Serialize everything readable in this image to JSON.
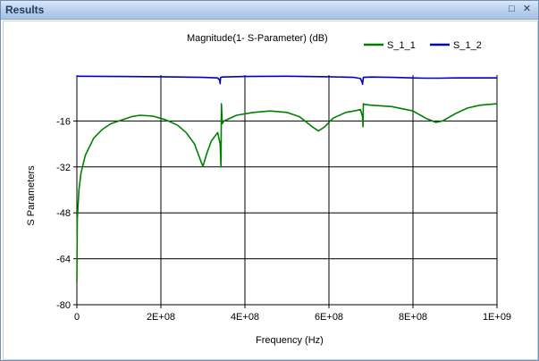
{
  "window": {
    "title": "Results",
    "maximize_icon": "maximize-icon",
    "close_icon": "close-icon"
  },
  "chart_data": {
    "type": "line",
    "title": "Magnitude(1- S-Parameter) (dB)",
    "xlabel": "Frequency (Hz)",
    "ylabel": "S Parameters",
    "xlim": [
      0,
      1000000000
    ],
    "ylim": [
      -80,
      0
    ],
    "x_ticks": [
      {
        "value": 0,
        "label": "0"
      },
      {
        "value": 200000000,
        "label": "2E+08"
      },
      {
        "value": 400000000,
        "label": "4E+08"
      },
      {
        "value": 600000000,
        "label": "6E+08"
      },
      {
        "value": 800000000,
        "label": "8E+08"
      },
      {
        "value": 1000000000,
        "label": "1E+09"
      }
    ],
    "y_ticks": [
      {
        "value": -16,
        "label": "-16"
      },
      {
        "value": -32,
        "label": "-32"
      },
      {
        "value": -48,
        "label": "-48"
      },
      {
        "value": -64,
        "label": "-64"
      },
      {
        "value": -80,
        "label": "-80"
      }
    ],
    "grid": true,
    "legend_position": "top-right",
    "series": [
      {
        "name": "S_1_1",
        "color": "#008000",
        "x": [
          0,
          1000000,
          5000000,
          10000000,
          20000000,
          40000000,
          60000000,
          80000000,
          100000000,
          130000000,
          150000000,
          180000000,
          210000000,
          240000000,
          260000000,
          280000000,
          295000000,
          300000000,
          310000000,
          320000000,
          335000000,
          341000000,
          343000000,
          344000000,
          346000000,
          350000000,
          380000000,
          420000000,
          460000000,
          500000000,
          530000000,
          560000000,
          575000000,
          590000000,
          610000000,
          640000000,
          660000000,
          675000000,
          680000000,
          681000000,
          682000000,
          684000000,
          700000000,
          750000000,
          800000000,
          830000000,
          855000000,
          870000000,
          900000000,
          930000000,
          960000000,
          1000000000
        ],
        "y": [
          -72,
          -50,
          -40,
          -34,
          -28,
          -22,
          -19,
          -17,
          -16,
          -14.5,
          -14,
          -14.3,
          -15.5,
          -17.5,
          -20,
          -24,
          -30,
          -31.8,
          -27,
          -23,
          -20,
          -24,
          -32,
          -10,
          -17,
          -16,
          -14,
          -13,
          -12.5,
          -13,
          -14.5,
          -18,
          -19.5,
          -18,
          -15,
          -13,
          -12.5,
          -12,
          -14.5,
          -18,
          -10,
          -10.2,
          -10.5,
          -11,
          -12.5,
          -15,
          -16.5,
          -16,
          -13.5,
          -11.5,
          -10.5,
          -10
        ]
      },
      {
        "name": "S_1_2",
        "color": "#0000cc",
        "x": [
          0,
          100000000,
          200000000,
          300000000,
          335000000,
          340000000,
          341000000,
          342000000,
          345000000,
          400000000,
          500000000,
          600000000,
          660000000,
          675000000,
          679000000,
          680000000,
          682000000,
          700000000,
          750000000,
          800000000,
          830000000,
          860000000,
          900000000,
          950000000,
          1000000000
        ],
        "y": [
          -0.4,
          -0.5,
          -0.6,
          -0.8,
          -1.0,
          -1.8,
          -3.0,
          -0.9,
          -0.7,
          -0.5,
          -0.4,
          -0.6,
          -0.8,
          -1.2,
          -2.5,
          -3.2,
          -0.8,
          -0.7,
          -0.8,
          -1.0,
          -1.1,
          -1.1,
          -1.0,
          -1.0,
          -1.0
        ]
      }
    ]
  }
}
